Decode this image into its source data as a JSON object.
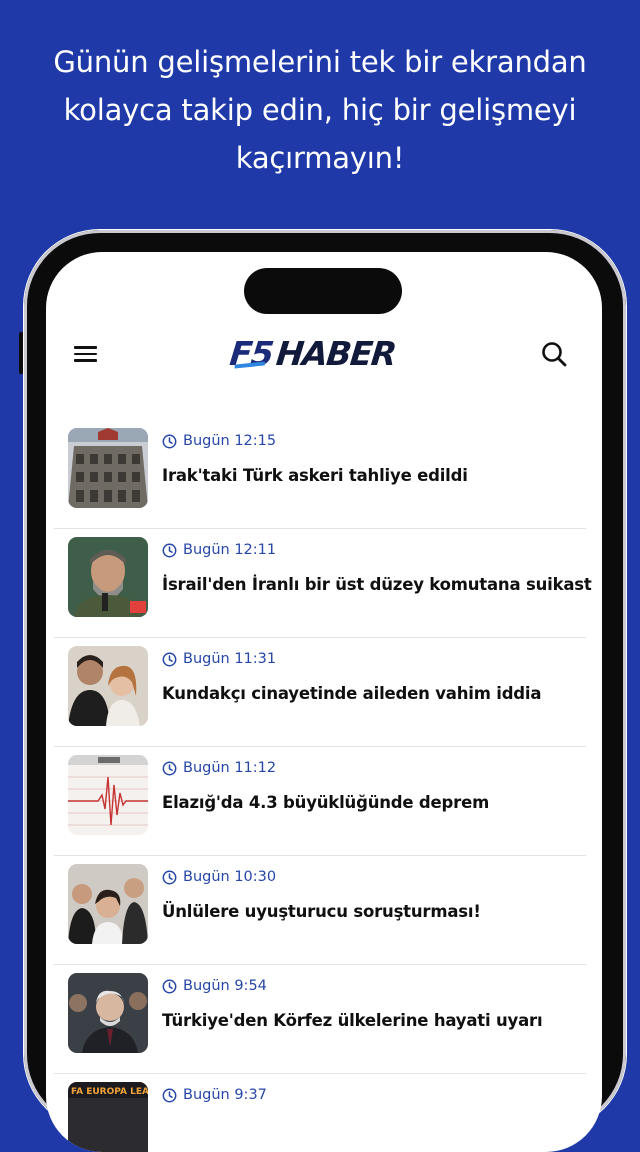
{
  "promo": {
    "line1": "Günün gelişmelerini tek bir ekrandan",
    "line2": "kolayca takip edin, hiç bir gelişmeyi",
    "line3": "kaçırmayın!"
  },
  "app": {
    "logo_mark": "F5",
    "logo_text": "HABER"
  },
  "colors": {
    "background": "#1f3aa8",
    "accent": "#2747a8",
    "logo": "#1c2a7a"
  },
  "icons": {
    "menu": "hamburger-menu-icon",
    "search": "search-icon",
    "time": "clock-icon"
  },
  "news": [
    {
      "time": "Bugün 12:15",
      "title": "Irak'taki Türk askeri tahliye edildi"
    },
    {
      "time": "Bugün 12:11",
      "title": "İsrail'den İranlı bir üst düzey komutana suikast"
    },
    {
      "time": "Bugün 11:31",
      "title": "Kundakçı cinayetinde aileden vahim iddia"
    },
    {
      "time": "Bugün 11:12",
      "title": "Elazığ'da 4.3 büyüklüğünde deprem"
    },
    {
      "time": "Bugün 10:30",
      "title": "Ünlülere uyuşturucu soruşturması!"
    },
    {
      "time": "Bugün 9:54",
      "title": "Türkiye'den Körfez ülkelerine hayati uyarı"
    },
    {
      "time": "Bugün 9:37",
      "title": ""
    }
  ]
}
